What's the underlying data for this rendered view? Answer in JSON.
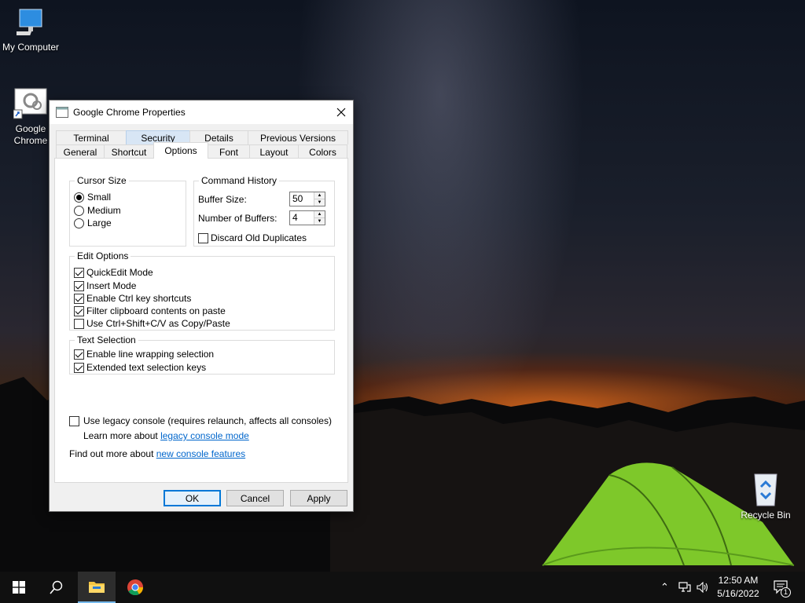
{
  "desktop": {
    "icons": [
      {
        "label": "My Computer"
      },
      {
        "label": "Google Chrome"
      },
      {
        "label": "Recycle Bin"
      }
    ]
  },
  "dialog": {
    "title": "Google Chrome Properties",
    "tabs_back": [
      "Terminal",
      "Security",
      "Details",
      "Previous Versions"
    ],
    "tabs_front": [
      "General",
      "Shortcut",
      "Options",
      "Font",
      "Layout",
      "Colors"
    ],
    "active_tab": "Options",
    "cursor_size": {
      "label": "Cursor Size",
      "options": [
        "Small",
        "Medium",
        "Large"
      ],
      "selected": "Small"
    },
    "command_history": {
      "label": "Command History",
      "buffer_size_label": "Buffer Size:",
      "buffer_size_value": "50",
      "num_buffers_label": "Number of Buffers:",
      "num_buffers_value": "4",
      "discard_label": "Discard Old Duplicates",
      "discard_checked": false
    },
    "edit_options": {
      "label": "Edit Options",
      "items": [
        {
          "label": "QuickEdit Mode",
          "checked": true
        },
        {
          "label": "Insert Mode",
          "checked": true
        },
        {
          "label": "Enable Ctrl key shortcuts",
          "checked": true
        },
        {
          "label": "Filter clipboard contents on paste",
          "checked": true
        },
        {
          "label": "Use Ctrl+Shift+C/V as Copy/Paste",
          "checked": false
        }
      ]
    },
    "text_selection": {
      "label": "Text Selection",
      "items": [
        {
          "label": "Enable line wrapping selection",
          "checked": true
        },
        {
          "label": "Extended text selection keys",
          "checked": true
        }
      ]
    },
    "legacy": {
      "label": "Use legacy console (requires relaunch, affects all consoles)",
      "checked": false,
      "learn_more_prefix": "Learn more about",
      "learn_more_link": "legacy console mode"
    },
    "find_out": {
      "prefix": "Find out more about",
      "link": "new console features"
    },
    "buttons": {
      "ok": "OK",
      "cancel": "Cancel",
      "apply": "Apply"
    }
  },
  "taskbar": {
    "time": "12:50 AM",
    "date": "5/16/2022",
    "notification_count": "1"
  }
}
